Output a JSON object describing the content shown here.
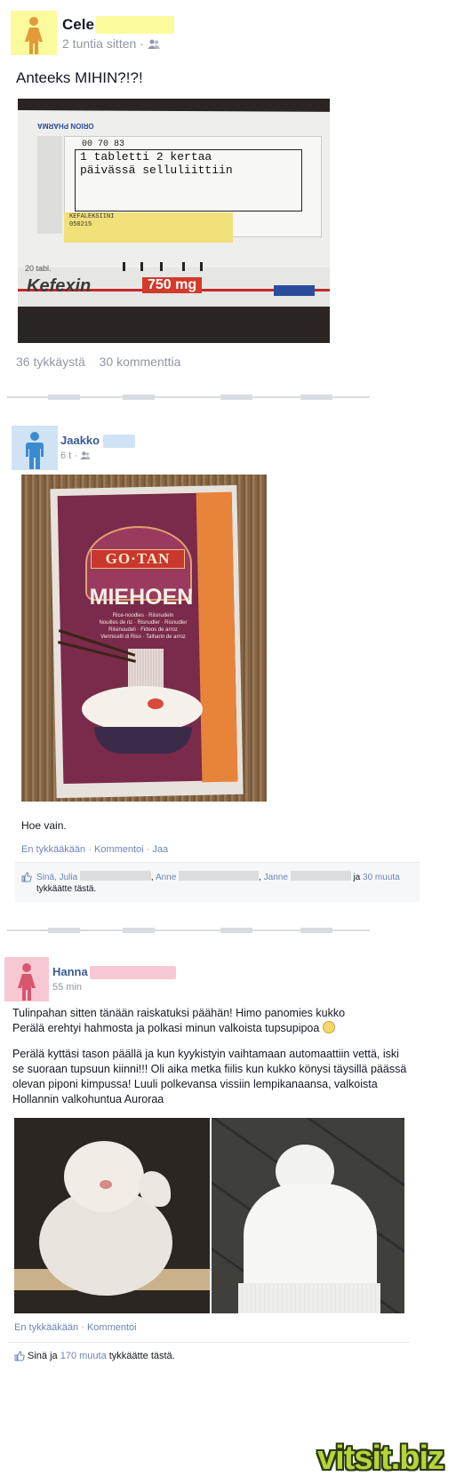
{
  "colors": {
    "female_avatar_bg": "#fbfa9c",
    "female_avatar_fig": "#e29a3a",
    "male_avatar_bg": "#cfe3f5",
    "male_avatar_fig": "#3a8bd0",
    "pink_avatar_bg": "#f7c8d3",
    "pink_avatar_fig": "#d9576e",
    "name_mask_yellow": "#fbfa9c",
    "name_mask_blue": "#cfe3f5",
    "name_mask_pink": "#f7c8d3",
    "link": "#6d84b4",
    "watermark": "#b6d43a"
  },
  "post1": {
    "author": "Cele",
    "time": "2 tuntia sitten",
    "audience_icon": "friends-icon",
    "text": "Anteeks MIHIN?!?!",
    "photo": {
      "box_number": "00 70 83",
      "label_line1": "1 tabletti 2 kertaa",
      "label_line2": "päivässä selluliittiin",
      "label_small": "KEFALEKSIINI",
      "label_code": "050215",
      "brand": "Kefexin",
      "dose": "750 mg",
      "pharma": "ORION PHARMA",
      "count": "20 tabl."
    },
    "likes": "36 tykkäystä",
    "comments": "30 kommenttia"
  },
  "post2": {
    "author": "Jaakko",
    "time": "6 t",
    "audience_icon": "friends-icon",
    "photo": {
      "brand": "GO·TAN",
      "product": "MIEHOEN",
      "sub1": "Rice-noodles · Riisnudeln",
      "sub2": "Nouilles de riz · Risnudler · Risnudler",
      "sub3": "Riisinuudeli · Fideos de arroz",
      "sub4": "Vermicelli di Riso · Talharin de arroz"
    },
    "text": "Hoe vain.",
    "actions": [
      "En tykkääkään",
      "Kommentoi",
      "Jaa"
    ],
    "likes_prefix": "Sinä, Julia",
    "likes_name2": "Anne",
    "likes_name3": "Janne",
    "likes_and": "ja",
    "likes_more": "30 muuta",
    "likes_suffix": "tykkäätte tästä."
  },
  "post3": {
    "author": "Hanna",
    "time": "55 min",
    "para1": "Tulinpahan sitten tänään raiskatuksi päähän! Himo panomies kukko Perälä erehtyi hahmosta ja polkasi minun valkoista tupsupipoa",
    "para2": "Perälä kyttäsi tason päällä ja kun kyykistyin vaihtamaan automaattiin vettä, iski se suoraan tupsuun kiinni!!! Oli aika metka fiilis kun kukko könysi täysillä päässä olevan piponi kimpussa! Luuli polkevansa vissiin lempikanaansa, valkoista Hollannin valkohuntua Auroraa",
    "actions": [
      "En tykkääkään",
      "Kommentoi"
    ],
    "likes_prefix": "Sinä ja",
    "likes_more": "170 muuta",
    "likes_suffix": "tykkäätte tästä."
  },
  "watermark": "vitsit.biz"
}
